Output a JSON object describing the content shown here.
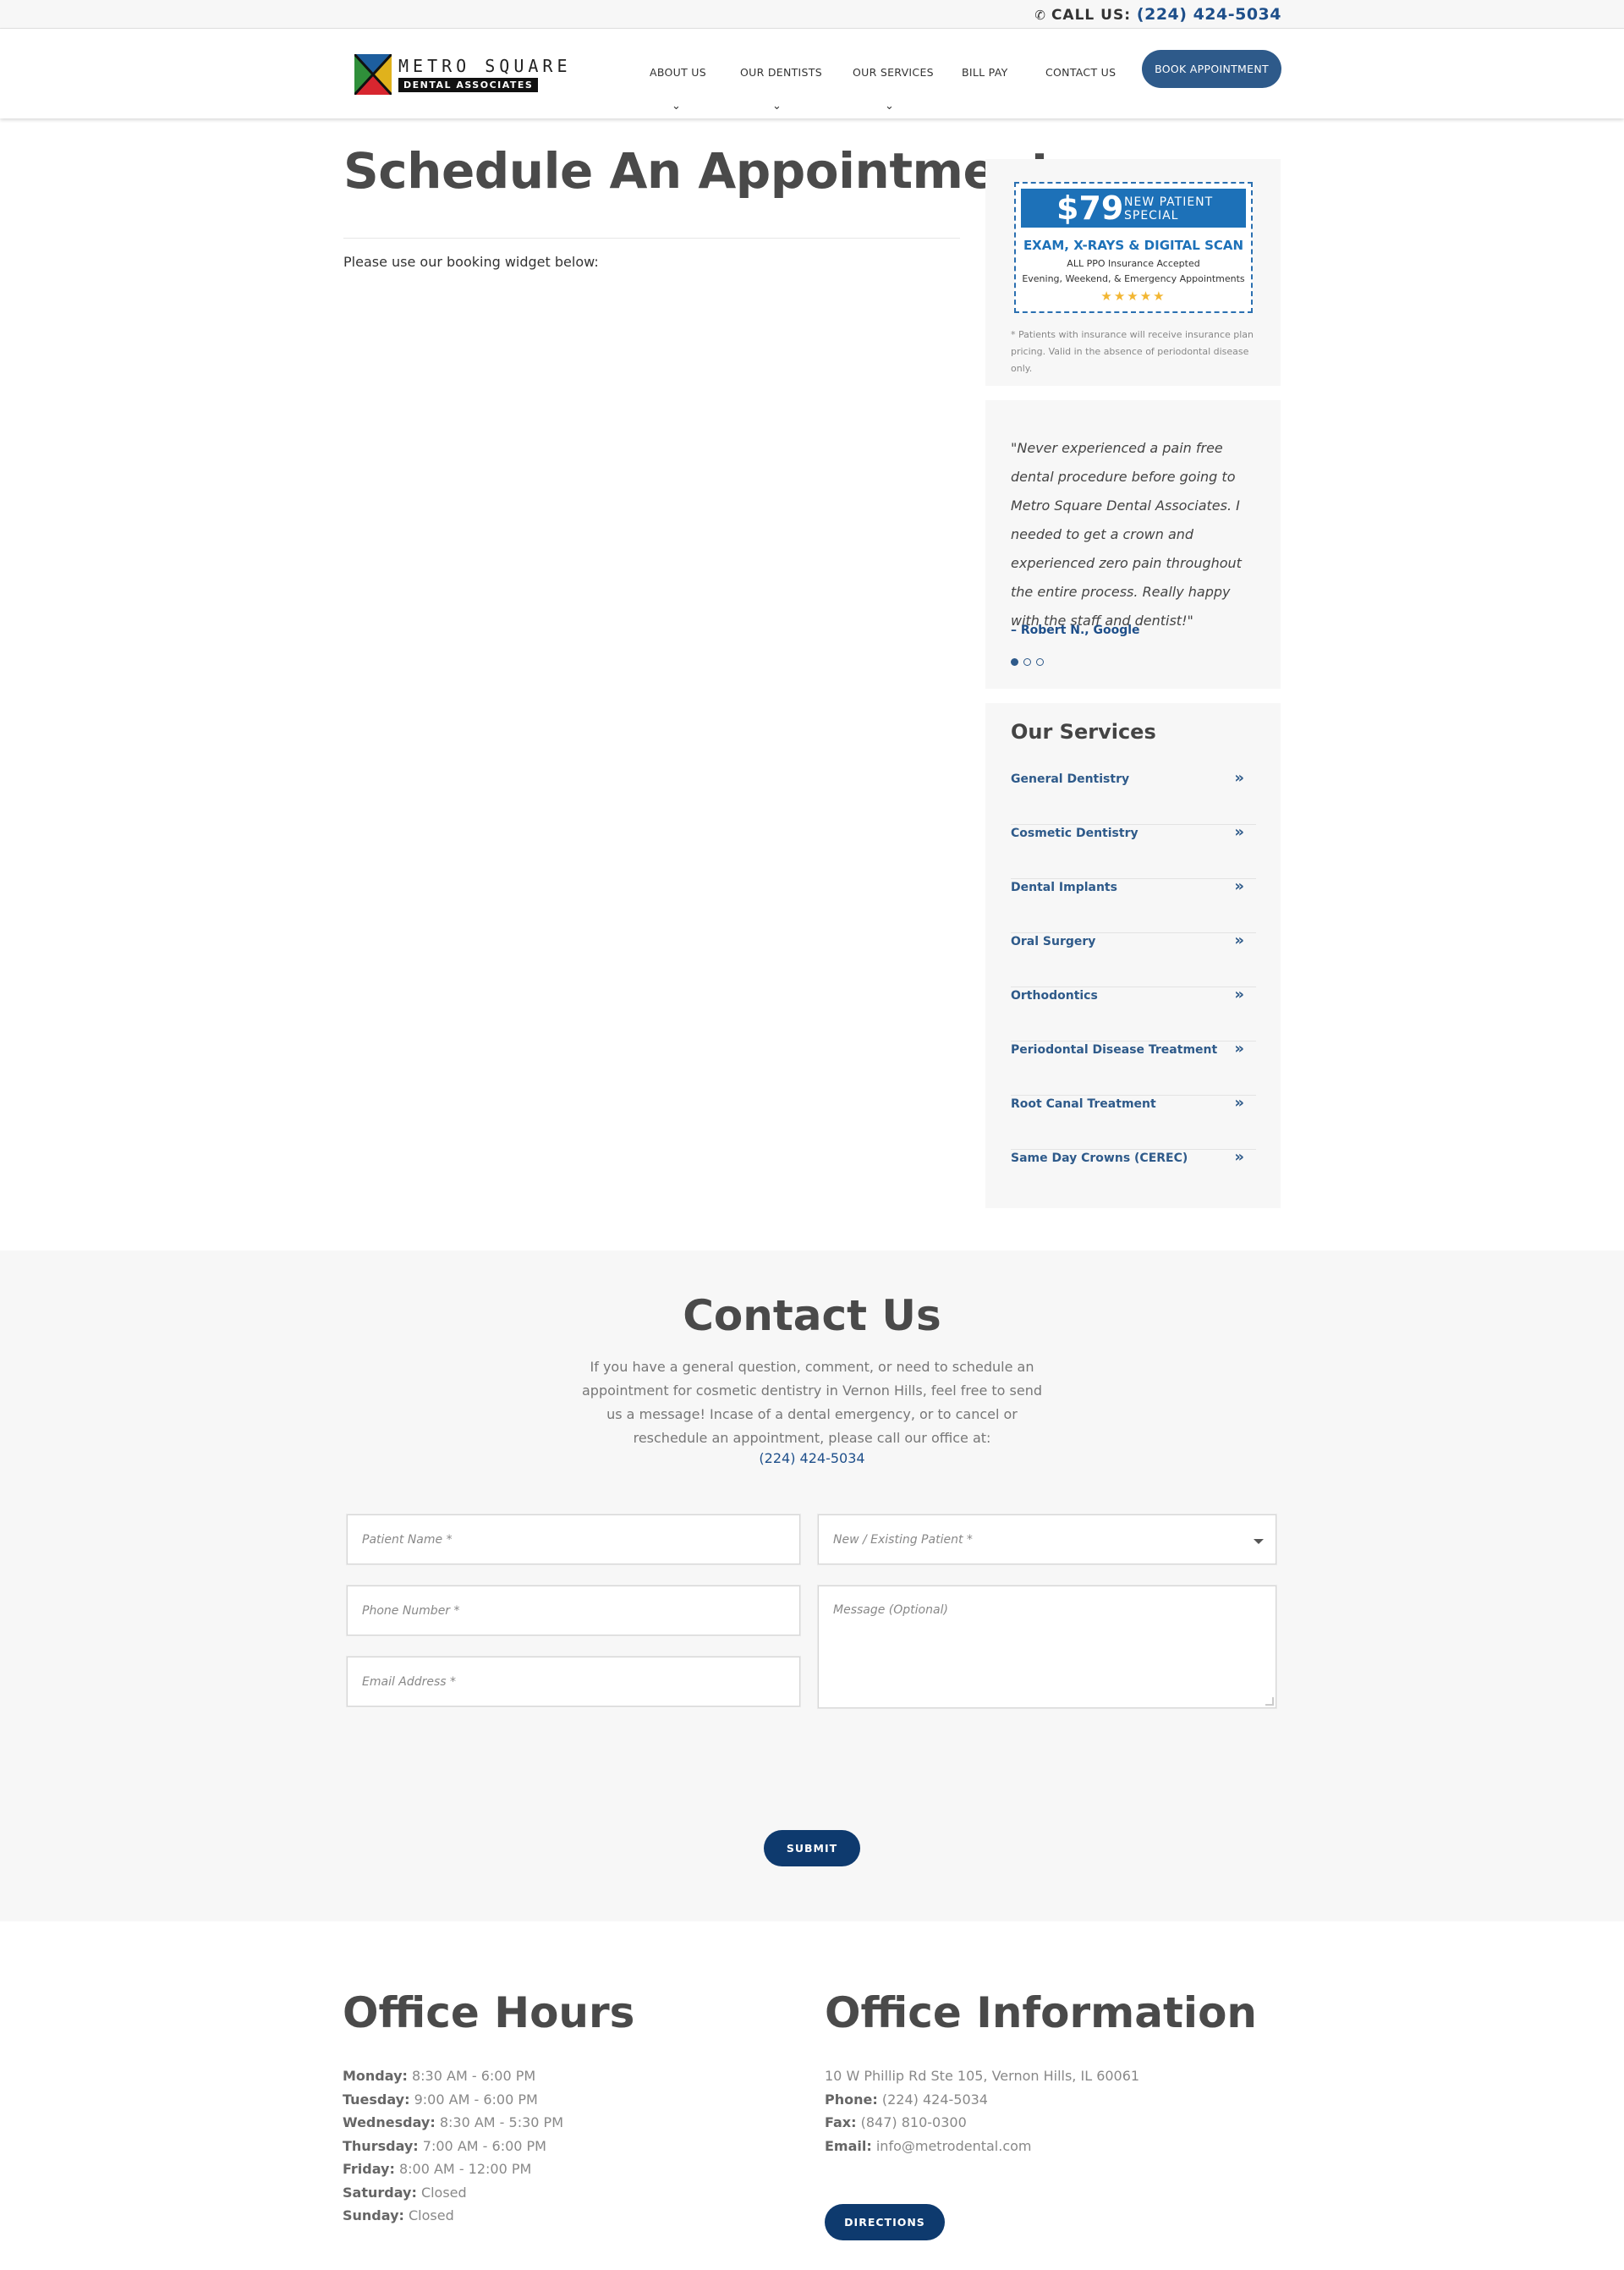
{
  "topbar": {
    "call_label": "CALL US:",
    "phone": "(224) 424-5034"
  },
  "logo": {
    "line1": "METRO SQUARE",
    "line2": "DENTAL ASSOCIATES"
  },
  "nav": {
    "items": [
      {
        "label": "ABOUT US"
      },
      {
        "label": "OUR DENTISTS"
      },
      {
        "label": "OUR SERVICES"
      },
      {
        "label": "BILL PAY"
      },
      {
        "label": "CONTACT US"
      }
    ],
    "book_label": "BOOK APPOINTMENT"
  },
  "main": {
    "title": "Schedule An Appointment",
    "intro": "Please use our booking widget below:"
  },
  "promo": {
    "price": "$79",
    "label": "NEW PATIENT SPECIAL",
    "headline": "EXAM, X-RAYS & DIGITAL SCAN",
    "sub1": "ALL PPO Insurance Accepted",
    "sub2": "Evening, Weekend, & Emergency Appointments",
    "stars": "★★★★★",
    "note": "* Patients with insurance will receive insurance plan pricing. Valid in the absence of periodontal disease only."
  },
  "review": {
    "quote": "\"Never experienced a pain free dental procedure before going to Metro Square Dental Associates. I needed to get a crown and experienced zero pain throughout the entire process. Really happy with the staff and dentist!\"",
    "author": "– Robert N., Google",
    "active_index": 0,
    "total": 3
  },
  "services": {
    "title": "Our Services",
    "items": [
      {
        "label": "General Dentistry"
      },
      {
        "label": "Cosmetic Dentistry"
      },
      {
        "label": "Dental Implants"
      },
      {
        "label": "Oral Surgery"
      },
      {
        "label": "Orthodontics"
      },
      {
        "label": "Periodontal Disease Treatment"
      },
      {
        "label": "Root Canal Treatment"
      },
      {
        "label": "Same Day Crowns (CEREC)"
      }
    ]
  },
  "contact": {
    "title": "Contact Us",
    "text": "If you have a general question, comment, or need to schedule an appointment for cosmetic dentistry in Vernon Hills, feel free to send us a message! Incase of a dental emergency, or to cancel or reschedule an appointment, please call our office at:",
    "phone": "(224) 424-5034",
    "fields": {
      "name": "Patient Name *",
      "patient_type": "New / Existing Patient *",
      "phone": "Phone Number *",
      "email": "Email Address *",
      "message": "Message (Optional)"
    },
    "submit": "SUBMIT"
  },
  "hours": {
    "title": "Office Hours",
    "rows": [
      {
        "day": "Monday:",
        "time": "8:30 AM - 6:00 PM"
      },
      {
        "day": "Tuesday:",
        "time": "9:00 AM - 6:00 PM"
      },
      {
        "day": "Wednesday:",
        "time": "8:30 AM - 5:30 PM"
      },
      {
        "day": "Thursday:",
        "time": "7:00 AM - 6:00 PM"
      },
      {
        "day": "Friday:",
        "time": "8:00 AM - 12:00 PM"
      },
      {
        "day": "Saturday:",
        "time": "Closed"
      },
      {
        "day": "Sunday:",
        "time": "Closed"
      }
    ]
  },
  "office": {
    "title": "Office Information",
    "address": "10 W Phillip Rd Ste 105, Vernon Hills, IL 60061",
    "phone_label": "Phone:",
    "phone": "(224) 424-5034",
    "fax_label": "Fax:",
    "fax": "(847) 810-0300",
    "email_label": "Email:",
    "email": "info@metrodental.com",
    "directions": "DIRECTIONS"
  }
}
